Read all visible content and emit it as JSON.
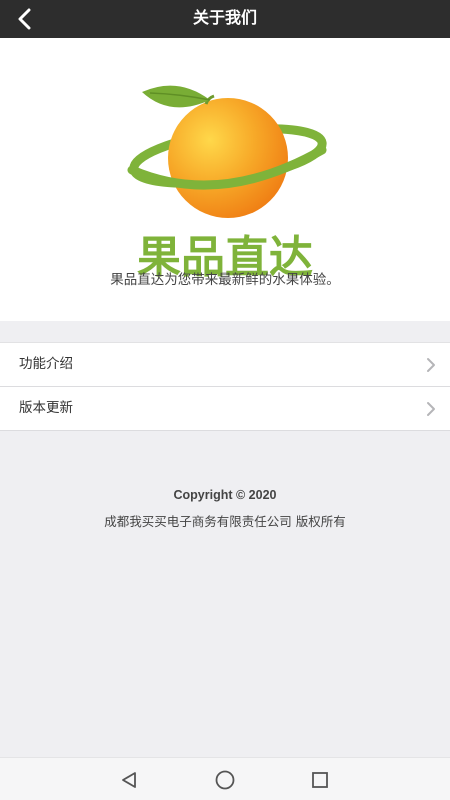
{
  "header": {
    "title": "关于我们",
    "back_icon": "chevron-left-icon"
  },
  "hero": {
    "brand_name": "果品直达",
    "tagline": "果品直达为您带来最新鲜的水果体验。"
  },
  "menu": {
    "items": [
      {
        "label": "功能介绍",
        "icon": "chevron-right-icon"
      },
      {
        "label": "版本更新",
        "icon": "chevron-right-icon"
      }
    ]
  },
  "footer": {
    "copyright": "Copyright © 2020",
    "company": "成都我买买电子商务有限责任公司 版权所有"
  },
  "navbar": {
    "icons": [
      "back-triangle-icon",
      "home-circle-icon",
      "recents-square-icon"
    ]
  },
  "colors": {
    "topbar": "#2d2d2d",
    "brand_green": "#7fb33a",
    "orange": "#f39a1e",
    "background": "#efeff2"
  }
}
